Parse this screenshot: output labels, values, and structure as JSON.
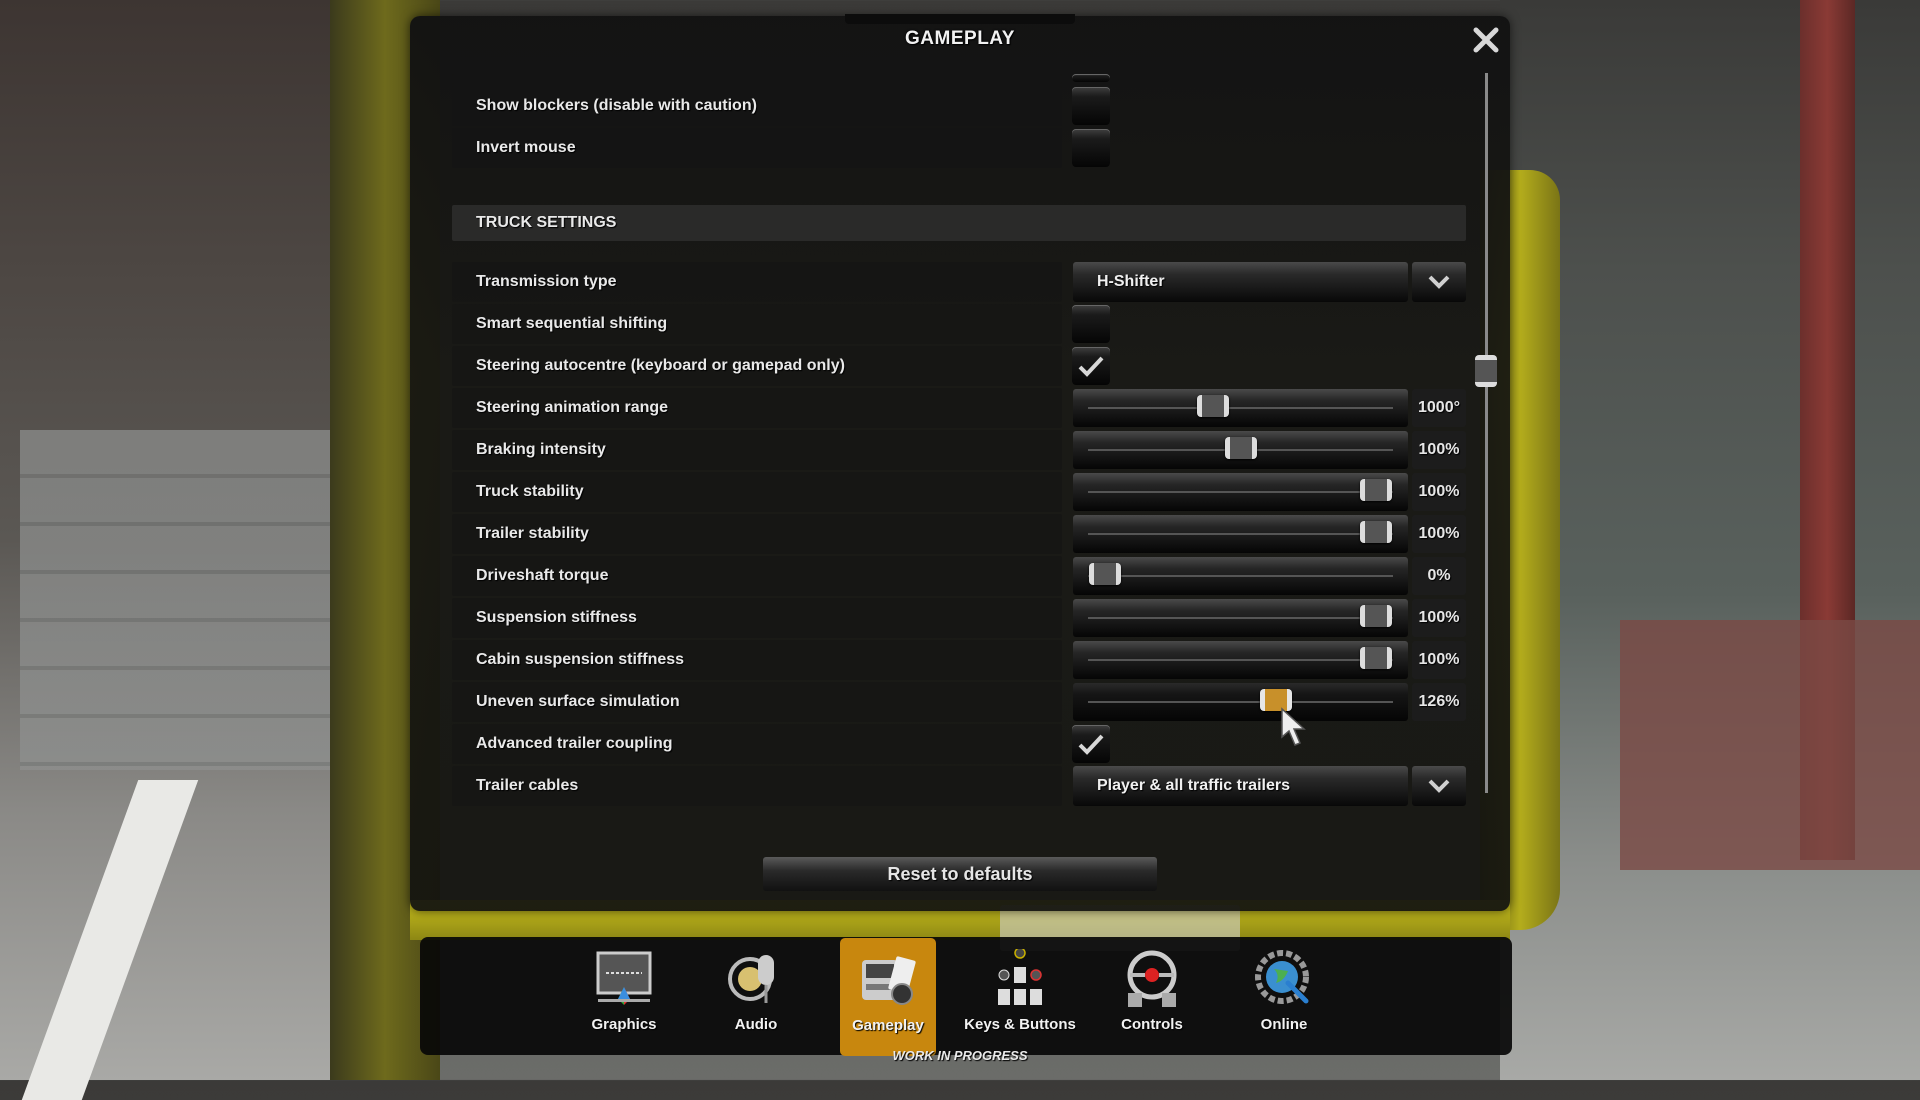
{
  "window": {
    "title": "GAMEPLAY"
  },
  "rows_top": [
    {
      "label": "Show blockers (disable with caution)",
      "type": "checkbox",
      "checked": false
    },
    {
      "label": "Invert mouse",
      "type": "checkbox",
      "checked": false
    }
  ],
  "section": {
    "title": "TRUCK SETTINGS"
  },
  "settings": {
    "transmission_type": {
      "label": "Transmission type",
      "value": "H-Shifter"
    },
    "smart_sequential_shifting": {
      "label": "Smart sequential shifting",
      "checked": false
    },
    "steering_autocentre": {
      "label": "Steering autocentre (keyboard or gamepad only)",
      "checked": true
    },
    "steering_animation_range": {
      "label": "Steering animation range",
      "value": "1000°",
      "position": 0.4
    },
    "braking_intensity": {
      "label": "Braking intensity",
      "value": "100%",
      "position": 0.5
    },
    "truck_stability": {
      "label": "Truck stability",
      "value": "100%",
      "position": 1.0
    },
    "trailer_stability": {
      "label": "Trailer stability",
      "value": "100%",
      "position": 1.0
    },
    "driveshaft_torque": {
      "label": "Driveshaft torque",
      "value": "0%",
      "position": 0.0
    },
    "suspension_stiffness": {
      "label": "Suspension stiffness",
      "value": "100%",
      "position": 1.0
    },
    "cabin_suspension_stiffness": {
      "label": "Cabin suspension stiffness",
      "value": "100%",
      "position": 1.0
    },
    "uneven_surface_simulation": {
      "label": "Uneven surface simulation",
      "value": "126%",
      "position": 0.63,
      "hovered": true
    },
    "advanced_trailer_coupling": {
      "label": "Advanced trailer coupling",
      "checked": true
    },
    "trailer_cables": {
      "label": "Trailer cables",
      "value": "Player & all traffic trailers"
    }
  },
  "scroll_position": 0.41,
  "buttons": {
    "reset": "Reset to defaults"
  },
  "tabs": [
    {
      "label": "Graphics",
      "icon": "monitor-icon",
      "active": false
    },
    {
      "label": "Audio",
      "icon": "speaker-microphone-icon",
      "active": false
    },
    {
      "label": "Gameplay",
      "icon": "truck-clipboard-icon",
      "active": true
    },
    {
      "label": "Keys & Buttons",
      "icon": "keys-buttons-icon",
      "active": false
    },
    {
      "label": "Controls",
      "icon": "steering-wheel-icon",
      "active": false
    },
    {
      "label": "Online",
      "icon": "globe-gear-icon",
      "active": false
    }
  ],
  "footer": {
    "status": "WORK IN PROGRESS"
  },
  "colors": {
    "accent": "#c8870e",
    "panel": "#161616",
    "text": "#e9e9e9"
  }
}
